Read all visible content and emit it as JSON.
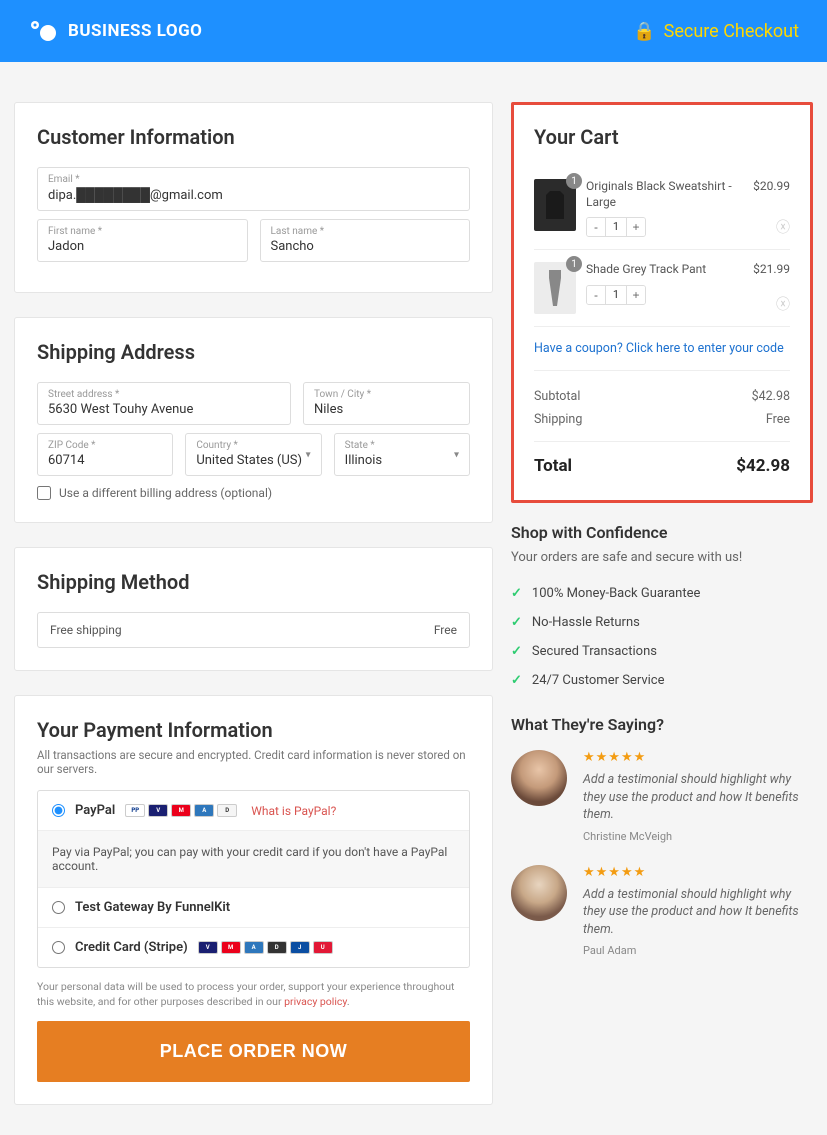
{
  "header": {
    "logo_text": "BUSINESS LOGO",
    "secure_text": "Secure Checkout"
  },
  "customer": {
    "title": "Customer Information",
    "email_label": "Email *",
    "email_value": "dipa.████████@gmail.com",
    "first_label": "First name *",
    "first_value": "Jadon",
    "last_label": "Last name *",
    "last_value": "Sancho"
  },
  "shipping": {
    "title": "Shipping Address",
    "street_label": "Street address *",
    "street_value": "5630 West Touhy Avenue",
    "town_label": "Town / City *",
    "town_value": "Niles",
    "zip_label": "ZIP Code *",
    "zip_value": "60714",
    "country_label": "Country *",
    "country_value": "United States (US)",
    "state_label": "State *",
    "state_value": "Illinois",
    "diff_billing": "Use a different billing address (optional)"
  },
  "method": {
    "title": "Shipping Method",
    "option_name": "Free shipping",
    "option_price": "Free"
  },
  "payment": {
    "title": "Your Payment Information",
    "subnote": "All transactions are secure and encrypted. Credit card information is never stored on our servers.",
    "paypal": "PayPal",
    "what_is_paypal": "What is PayPal?",
    "paypal_desc": "Pay via PayPal; you can pay with your credit card if you don't have a PayPal account.",
    "test_gateway": "Test Gateway By FunnelKit",
    "stripe": "Credit Card (Stripe)",
    "privacy_note_1": "Your personal data will be used to process your order, support your experience throughout this website, and for other purposes described in our ",
    "privacy_link": "privacy policy",
    "place_order": "PLACE ORDER NOW"
  },
  "cart": {
    "title": "Your Cart",
    "items": [
      {
        "name": "Originals Black Sweatshirt - Large",
        "qty": "1",
        "price": "$20.99",
        "badge": "1"
      },
      {
        "name": "Shade Grey Track Pant",
        "qty": "1",
        "price": "$21.99",
        "badge": "1"
      }
    ],
    "coupon_text": "Have a coupon? Click here to enter your code",
    "subtotal_label": "Subtotal",
    "subtotal_value": "$42.98",
    "shipping_label": "Shipping",
    "shipping_value": "Free",
    "total_label": "Total",
    "total_value": "$42.98"
  },
  "confidence": {
    "title": "Shop with Confidence",
    "sub": "Your orders are safe and secure with us!",
    "items": [
      "100% Money-Back Guarantee",
      "No-Hassle Returns",
      "Secured Transactions",
      "24/7 Customer Service"
    ]
  },
  "testimonials": {
    "title": "What They're Saying?",
    "items": [
      {
        "quote": "Add a testimonial should highlight why they use the product and how It benefits them.",
        "author": "Christine McVeigh"
      },
      {
        "quote": "Add a testimonial should highlight why they use the product and how It benefits them.",
        "author": "Paul Adam"
      }
    ]
  }
}
